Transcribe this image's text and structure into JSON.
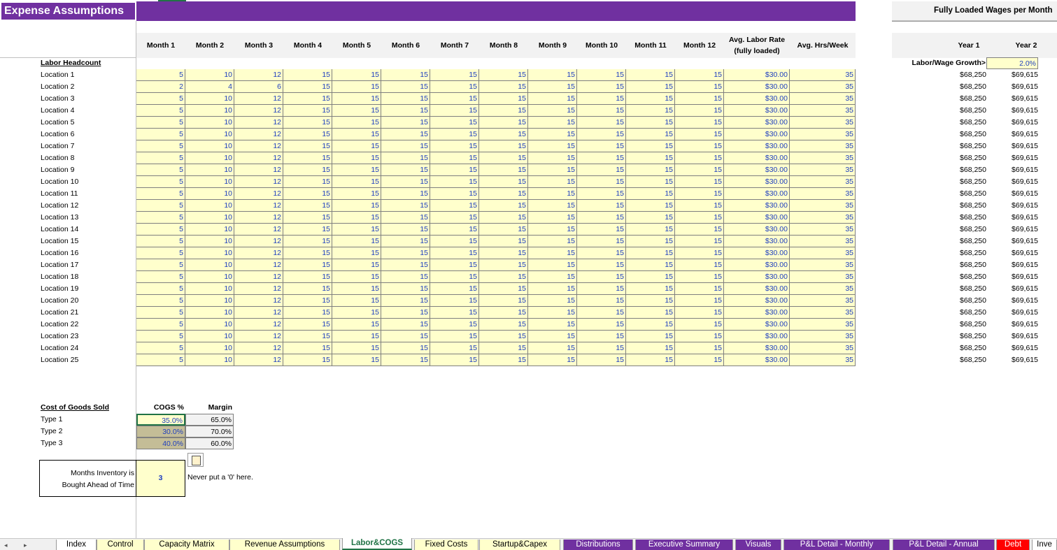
{
  "title": "Expense Assumptions",
  "right_title": "Fully Loaded Wages per Month",
  "columns": {
    "months": [
      "Month 1",
      "Month 2",
      "Month 3",
      "Month 4",
      "Month 5",
      "Month 6",
      "Month 7",
      "Month 8",
      "Month 9",
      "Month 10",
      "Month 11",
      "Month 12"
    ],
    "avg_rate": "Avg. Labor Rate\n(fully loaded)",
    "avg_rate_l1": "Avg. Labor Rate",
    "avg_rate_l2": "(fully loaded)",
    "avg_hrs": "Avg. Hrs/Week",
    "year1": "Year 1",
    "year2": "Year 2"
  },
  "labor_headcount_label": "Labor Headcount",
  "growth_label": "Labor/Wage Growth>",
  "growth_value": "2.0%",
  "rows": [
    {
      "label": "Location 1",
      "months": [
        "5",
        "10",
        "12",
        "15",
        "15",
        "15",
        "15",
        "15",
        "15",
        "15",
        "15",
        "15"
      ],
      "rate": "$30.00",
      "hrs": "35",
      "y1": "$68,250",
      "y2": "$69,615"
    },
    {
      "label": "Location 2",
      "months": [
        "2",
        "4",
        "6",
        "15",
        "15",
        "15",
        "15",
        "15",
        "15",
        "15",
        "15",
        "15"
      ],
      "rate": "$30.00",
      "hrs": "35",
      "y1": "$68,250",
      "y2": "$69,615"
    },
    {
      "label": "Location 3",
      "months": [
        "5",
        "10",
        "12",
        "15",
        "15",
        "15",
        "15",
        "15",
        "15",
        "15",
        "15",
        "15"
      ],
      "rate": "$30.00",
      "hrs": "35",
      "y1": "$68,250",
      "y2": "$69,615"
    },
    {
      "label": "Location 4",
      "months": [
        "5",
        "10",
        "12",
        "15",
        "15",
        "15",
        "15",
        "15",
        "15",
        "15",
        "15",
        "15"
      ],
      "rate": "$30.00",
      "hrs": "35",
      "y1": "$68,250",
      "y2": "$69,615"
    },
    {
      "label": "Location 5",
      "months": [
        "5",
        "10",
        "12",
        "15",
        "15",
        "15",
        "15",
        "15",
        "15",
        "15",
        "15",
        "15"
      ],
      "rate": "$30.00",
      "hrs": "35",
      "y1": "$68,250",
      "y2": "$69,615"
    },
    {
      "label": "Location 6",
      "months": [
        "5",
        "10",
        "12",
        "15",
        "15",
        "15",
        "15",
        "15",
        "15",
        "15",
        "15",
        "15"
      ],
      "rate": "$30.00",
      "hrs": "35",
      "y1": "$68,250",
      "y2": "$69,615"
    },
    {
      "label": "Location 7",
      "months": [
        "5",
        "10",
        "12",
        "15",
        "15",
        "15",
        "15",
        "15",
        "15",
        "15",
        "15",
        "15"
      ],
      "rate": "$30.00",
      "hrs": "35",
      "y1": "$68,250",
      "y2": "$69,615"
    },
    {
      "label": "Location 8",
      "months": [
        "5",
        "10",
        "12",
        "15",
        "15",
        "15",
        "15",
        "15",
        "15",
        "15",
        "15",
        "15"
      ],
      "rate": "$30.00",
      "hrs": "35",
      "y1": "$68,250",
      "y2": "$69,615"
    },
    {
      "label": "Location 9",
      "months": [
        "5",
        "10",
        "12",
        "15",
        "15",
        "15",
        "15",
        "15",
        "15",
        "15",
        "15",
        "15"
      ],
      "rate": "$30.00",
      "hrs": "35",
      "y1": "$68,250",
      "y2": "$69,615"
    },
    {
      "label": "Location 10",
      "months": [
        "5",
        "10",
        "12",
        "15",
        "15",
        "15",
        "15",
        "15",
        "15",
        "15",
        "15",
        "15"
      ],
      "rate": "$30.00",
      "hrs": "35",
      "y1": "$68,250",
      "y2": "$69,615"
    },
    {
      "label": "Location 11",
      "months": [
        "5",
        "10",
        "12",
        "15",
        "15",
        "15",
        "15",
        "15",
        "15",
        "15",
        "15",
        "15"
      ],
      "rate": "$30.00",
      "hrs": "35",
      "y1": "$68,250",
      "y2": "$69,615"
    },
    {
      "label": "Location 12",
      "months": [
        "5",
        "10",
        "12",
        "15",
        "15",
        "15",
        "15",
        "15",
        "15",
        "15",
        "15",
        "15"
      ],
      "rate": "$30.00",
      "hrs": "35",
      "y1": "$68,250",
      "y2": "$69,615"
    },
    {
      "label": "Location 13",
      "months": [
        "5",
        "10",
        "12",
        "15",
        "15",
        "15",
        "15",
        "15",
        "15",
        "15",
        "15",
        "15"
      ],
      "rate": "$30.00",
      "hrs": "35",
      "y1": "$68,250",
      "y2": "$69,615"
    },
    {
      "label": "Location 14",
      "months": [
        "5",
        "10",
        "12",
        "15",
        "15",
        "15",
        "15",
        "15",
        "15",
        "15",
        "15",
        "15"
      ],
      "rate": "$30.00",
      "hrs": "35",
      "y1": "$68,250",
      "y2": "$69,615"
    },
    {
      "label": "Location 15",
      "months": [
        "5",
        "10",
        "12",
        "15",
        "15",
        "15",
        "15",
        "15",
        "15",
        "15",
        "15",
        "15"
      ],
      "rate": "$30.00",
      "hrs": "35",
      "y1": "$68,250",
      "y2": "$69,615"
    },
    {
      "label": "Location 16",
      "months": [
        "5",
        "10",
        "12",
        "15",
        "15",
        "15",
        "15",
        "15",
        "15",
        "15",
        "15",
        "15"
      ],
      "rate": "$30.00",
      "hrs": "35",
      "y1": "$68,250",
      "y2": "$69,615"
    },
    {
      "label": "Location 17",
      "months": [
        "5",
        "10",
        "12",
        "15",
        "15",
        "15",
        "15",
        "15",
        "15",
        "15",
        "15",
        "15"
      ],
      "rate": "$30.00",
      "hrs": "35",
      "y1": "$68,250",
      "y2": "$69,615"
    },
    {
      "label": "Location 18",
      "months": [
        "5",
        "10",
        "12",
        "15",
        "15",
        "15",
        "15",
        "15",
        "15",
        "15",
        "15",
        "15"
      ],
      "rate": "$30.00",
      "hrs": "35",
      "y1": "$68,250",
      "y2": "$69,615"
    },
    {
      "label": "Location 19",
      "months": [
        "5",
        "10",
        "12",
        "15",
        "15",
        "15",
        "15",
        "15",
        "15",
        "15",
        "15",
        "15"
      ],
      "rate": "$30.00",
      "hrs": "35",
      "y1": "$68,250",
      "y2": "$69,615"
    },
    {
      "label": "Location 20",
      "months": [
        "5",
        "10",
        "12",
        "15",
        "15",
        "15",
        "15",
        "15",
        "15",
        "15",
        "15",
        "15"
      ],
      "rate": "$30.00",
      "hrs": "35",
      "y1": "$68,250",
      "y2": "$69,615"
    },
    {
      "label": "Location 21",
      "months": [
        "5",
        "10",
        "12",
        "15",
        "15",
        "15",
        "15",
        "15",
        "15",
        "15",
        "15",
        "15"
      ],
      "rate": "$30.00",
      "hrs": "35",
      "y1": "$68,250",
      "y2": "$69,615"
    },
    {
      "label": "Location 22",
      "months": [
        "5",
        "10",
        "12",
        "15",
        "15",
        "15",
        "15",
        "15",
        "15",
        "15",
        "15",
        "15"
      ],
      "rate": "$30.00",
      "hrs": "35",
      "y1": "$68,250",
      "y2": "$69,615"
    },
    {
      "label": "Location 23",
      "months": [
        "5",
        "10",
        "12",
        "15",
        "15",
        "15",
        "15",
        "15",
        "15",
        "15",
        "15",
        "15"
      ],
      "rate": "$30.00",
      "hrs": "35",
      "y1": "$68,250",
      "y2": "$69,615"
    },
    {
      "label": "Location 24",
      "months": [
        "5",
        "10",
        "12",
        "15",
        "15",
        "15",
        "15",
        "15",
        "15",
        "15",
        "15",
        "15"
      ],
      "rate": "$30.00",
      "hrs": "35",
      "y1": "$68,250",
      "y2": "$69,615"
    },
    {
      "label": "Location 25",
      "months": [
        "5",
        "10",
        "12",
        "15",
        "15",
        "15",
        "15",
        "15",
        "15",
        "15",
        "15",
        "15"
      ],
      "rate": "$30.00",
      "hrs": "35",
      "y1": "$68,250",
      "y2": "$69,615"
    }
  ],
  "cogs": {
    "section_label": "Cost of Goods Sold",
    "col_cogs": "COGS %",
    "col_margin": "Margin",
    "rows": [
      {
        "label": "Type 1",
        "cogs": "35.0%",
        "margin": "65.0%"
      },
      {
        "label": "Type 2",
        "cogs": "30.0%",
        "margin": "70.0%"
      },
      {
        "label": "Type 3",
        "cogs": "40.0%",
        "margin": "60.0%"
      }
    ]
  },
  "inventory": {
    "label_line1": "Months Inventory is",
    "label_line2": "Bought Ahead of Time",
    "value": "3",
    "note": "Never put a '0' here."
  },
  "tabs": [
    {
      "label": "Index",
      "style": "white"
    },
    {
      "label": "Control",
      "style": "yellow"
    },
    {
      "label": "Capacity Matrix",
      "style": "yellow"
    },
    {
      "label": "Revenue Assumptions",
      "style": "yellow"
    },
    {
      "label": "Labor&COGS",
      "style": "active"
    },
    {
      "label": "Fixed Costs",
      "style": "yellow"
    },
    {
      "label": "Startup&Capex",
      "style": "yellow"
    },
    {
      "label": "Distributions",
      "style": "purple"
    },
    {
      "label": "Executive Summary",
      "style": "purple"
    },
    {
      "label": "Visuals",
      "style": "purple"
    },
    {
      "label": "P&L Detail - Monthly",
      "style": "purple"
    },
    {
      "label": "P&L Detail - Annual",
      "style": "purple"
    },
    {
      "label": "Debt",
      "style": "red"
    },
    {
      "label": "Inve",
      "style": "white"
    }
  ],
  "colors": {
    "header_purple": "#7030A0",
    "input_yellow": "#ffffcc",
    "input_blue": "#1f3fbf",
    "excel_green": "#217346"
  }
}
